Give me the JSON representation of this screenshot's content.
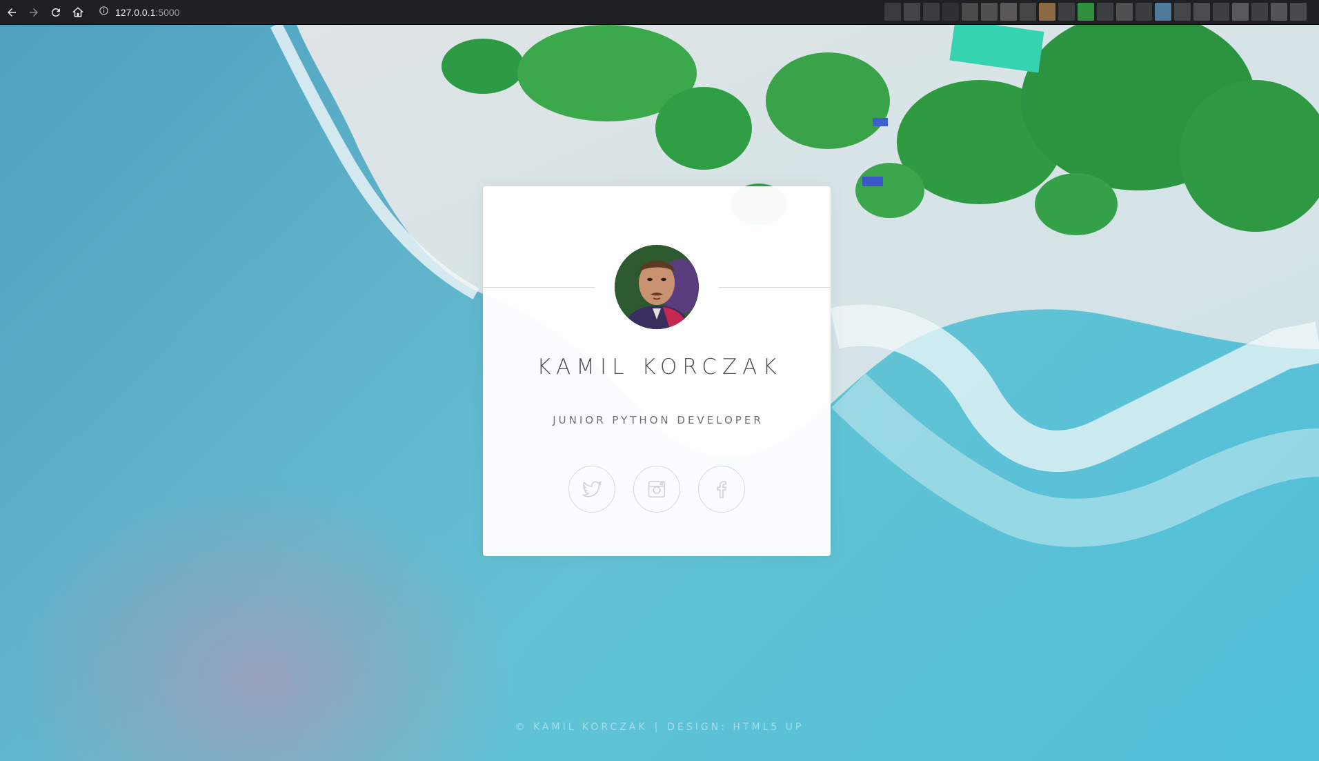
{
  "browser": {
    "url_host": "127.0.0.1",
    "url_port": ":5000",
    "extension_colors": [
      "#3a3b3e",
      "#434447",
      "#3b3c3f",
      "#2f3033",
      "#4b4a48",
      "#515050",
      "#5a5856",
      "#474644",
      "#8b6a44",
      "#3d3e40",
      "#2f8f3e",
      "#3e3f42",
      "#4f5050",
      "#3c3d40",
      "#4f7a9a",
      "#454648",
      "#4b4c4e",
      "#3e3f41",
      "#58595b",
      "#3f4042",
      "#535456",
      "#48494b"
    ]
  },
  "profile": {
    "name": "KAMIL KORCZAK",
    "role": "JUNIOR PYTHON DEVELOPER"
  },
  "socials": [
    {
      "name": "twitter",
      "icon": "twitter-icon"
    },
    {
      "name": "instagram",
      "icon": "instagram-icon"
    },
    {
      "name": "facebook",
      "icon": "facebook-icon"
    }
  ],
  "footer": {
    "copyright": "© KAMIL KORCZAK",
    "separator": "|",
    "design_prefix": "DESIGN: ",
    "design_link": "HTML5 UP"
  },
  "colors": {
    "card_bg": "#ffffff",
    "text": "#4c5153",
    "icon": "#cfd3d5"
  }
}
